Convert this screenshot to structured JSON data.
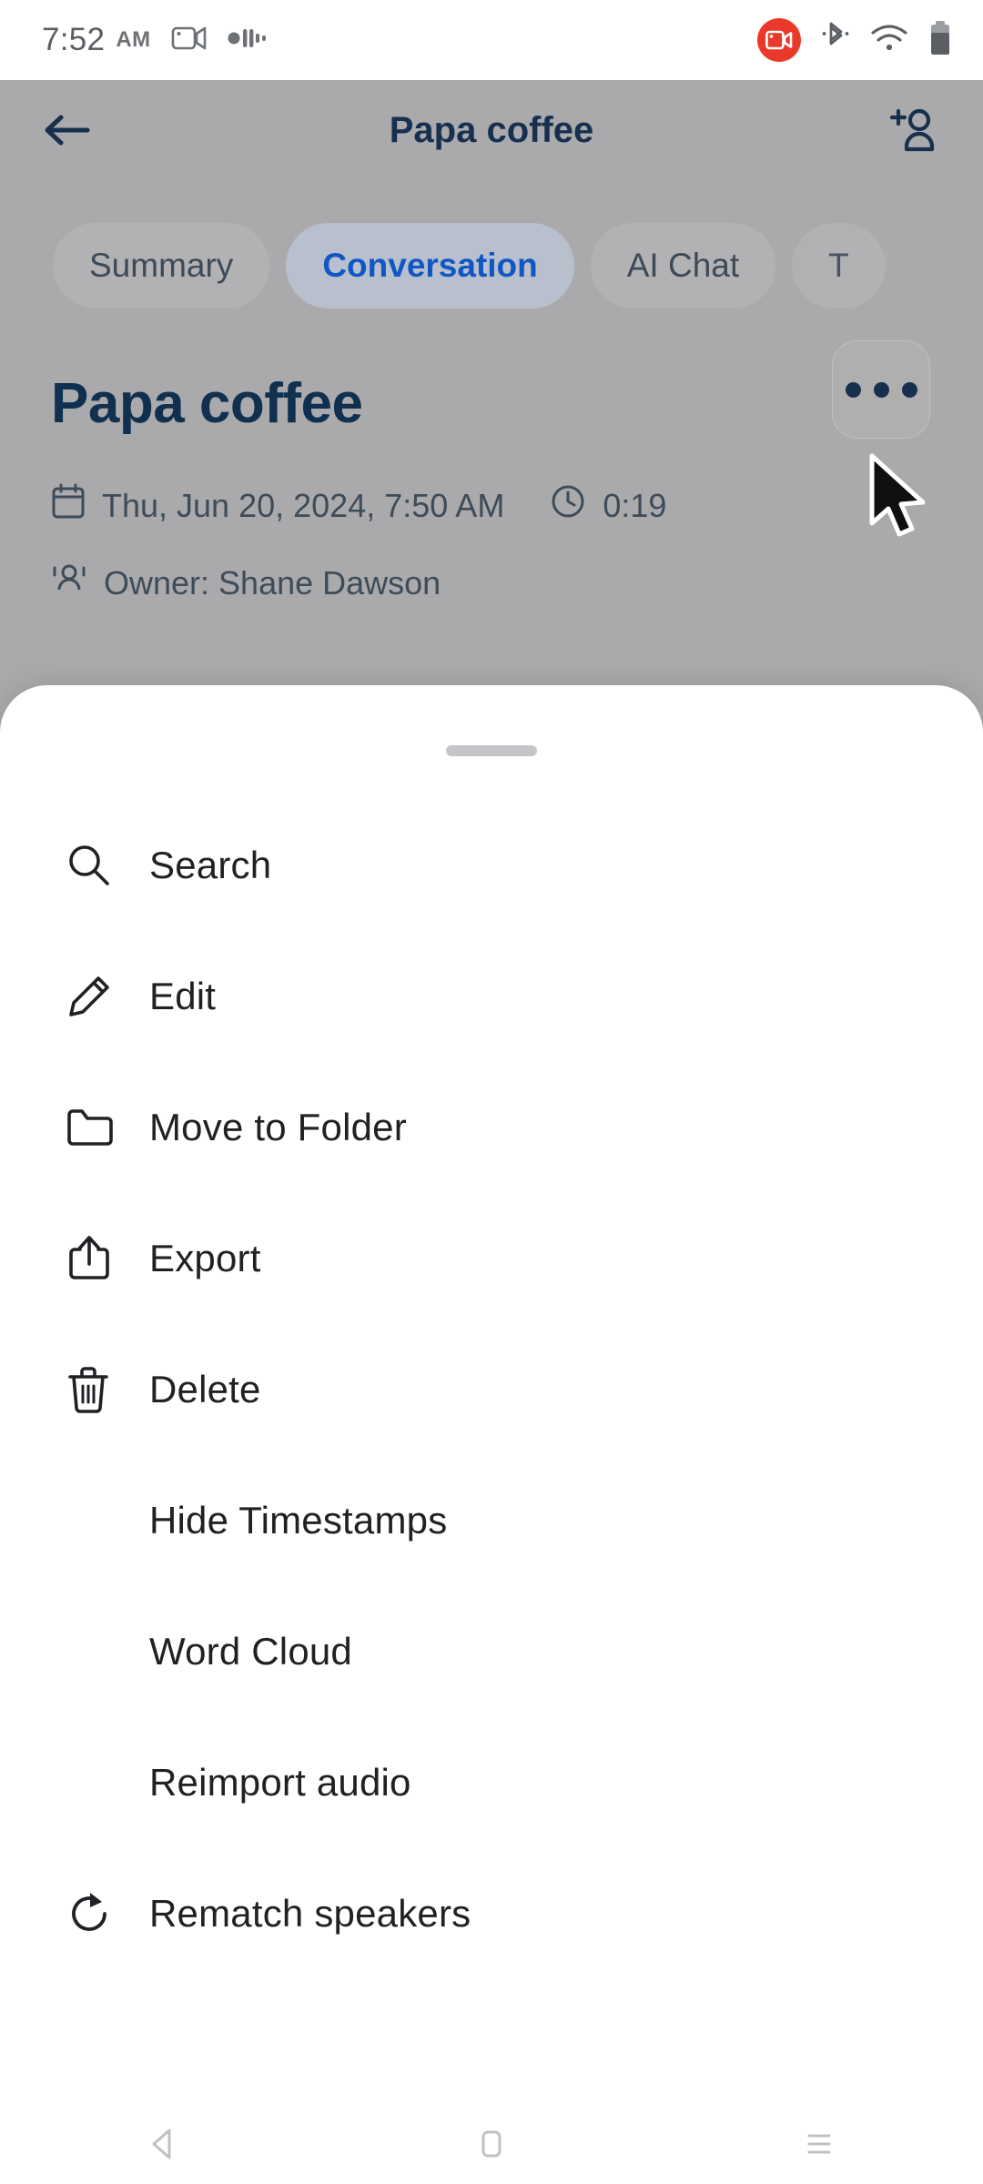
{
  "status_bar": {
    "time": "7:52",
    "ampm": "AM",
    "icons": [
      {
        "name": "video-camera-icon"
      },
      {
        "name": "audio-waveform-icon"
      },
      {
        "name": "screen-record-icon"
      },
      {
        "name": "bluetooth-icon"
      },
      {
        "name": "wifi-icon"
      },
      {
        "name": "battery-icon"
      }
    ]
  },
  "app_header": {
    "back_label": "",
    "title": "Papa coffee",
    "add_person_label": ""
  },
  "tabs": [
    {
      "label": "Summary",
      "active": false
    },
    {
      "label": "Conversation",
      "active": true
    },
    {
      "label": "AI Chat",
      "active": false
    },
    {
      "label": "T",
      "active": false
    }
  ],
  "note": {
    "title": "Papa coffee",
    "date": "Thu, Jun 20, 2024, 7:50 AM",
    "duration": "0:19",
    "owner": "Owner: Shane Dawson"
  },
  "sheet": {
    "menu_items": [
      {
        "label": "Search",
        "icon": "search-icon"
      },
      {
        "label": "Edit",
        "icon": "pencil-icon"
      },
      {
        "label": "Move to Folder",
        "icon": "folder-icon"
      },
      {
        "label": "Export",
        "icon": "share-upload-icon"
      },
      {
        "label": "Delete",
        "icon": "trash-icon"
      },
      {
        "label": "Hide Timestamps",
        "icon": "none"
      },
      {
        "label": "Word Cloud",
        "icon": "none"
      },
      {
        "label": "Reimport audio",
        "icon": "none"
      },
      {
        "label": "Rematch speakers",
        "icon": "refresh-icon"
      }
    ]
  },
  "nav_bar": {
    "back": "",
    "home": "",
    "recents": ""
  },
  "colors": {
    "accent_blue": "#1157c4",
    "title_navy": "#10304f",
    "record_red": "#e8392a",
    "scrim": "#aaaaac",
    "sheet_bg": "#ffffff"
  }
}
